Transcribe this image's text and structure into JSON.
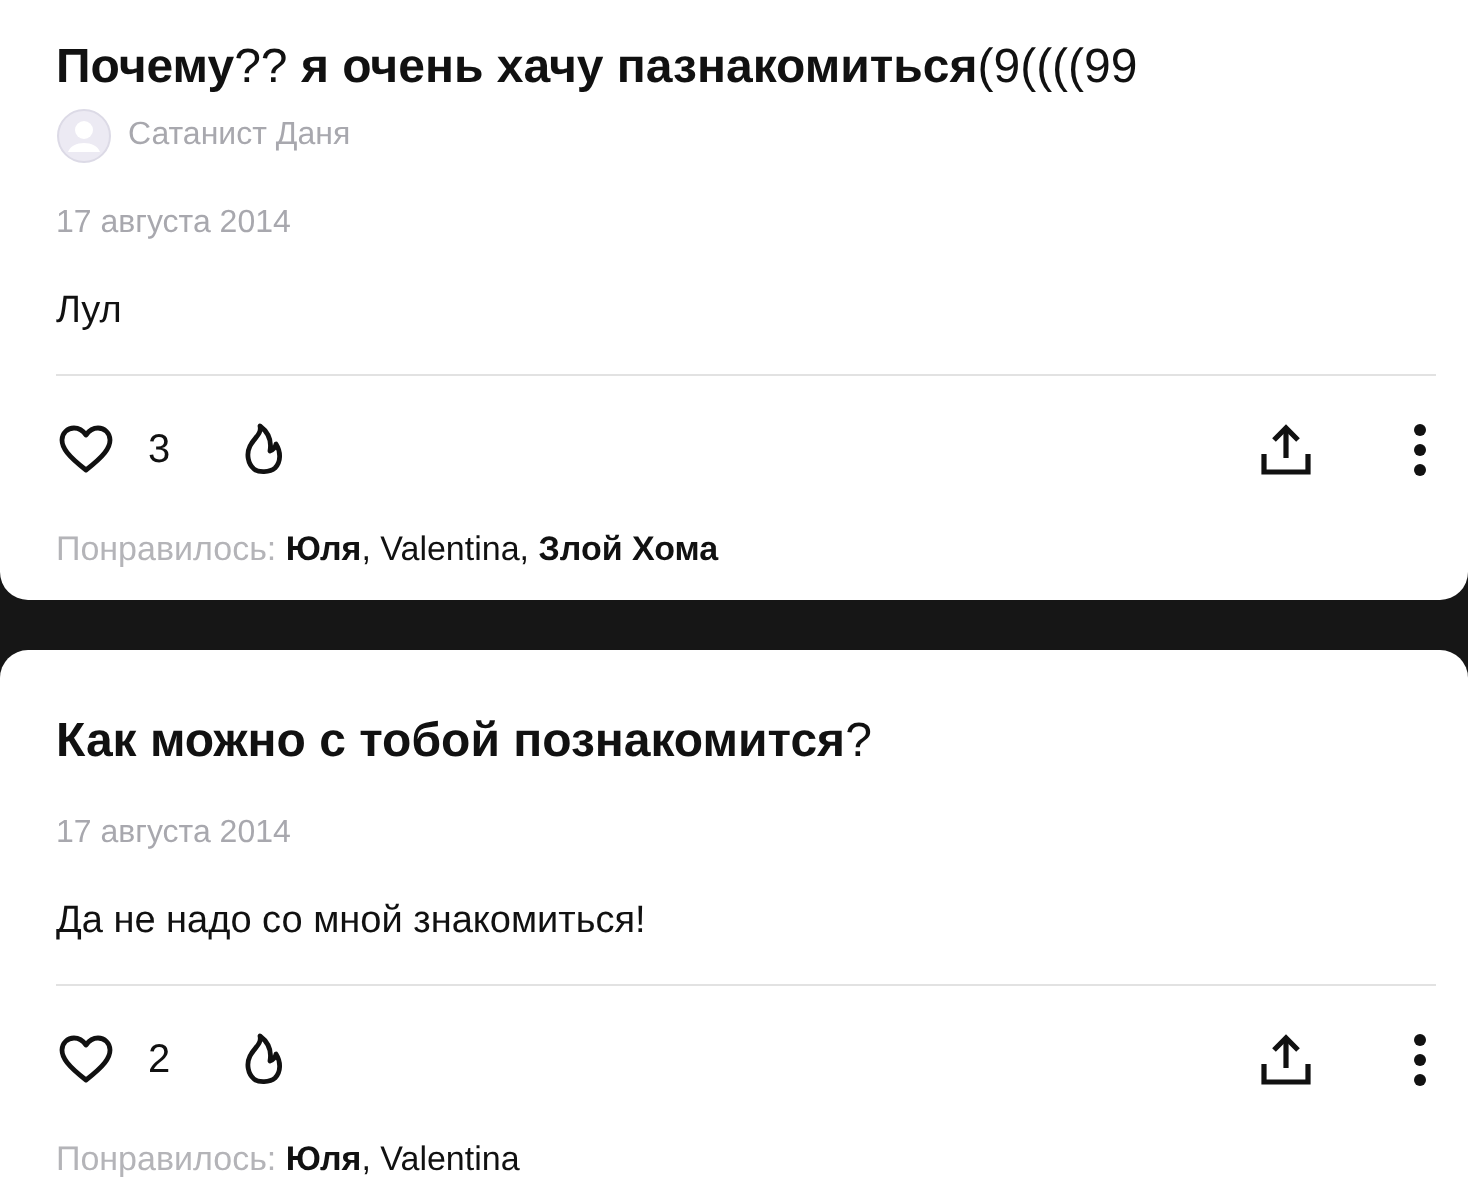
{
  "posts": [
    {
      "title": "**Почему**?? **я очень хачу пазнакомиться**(9((((99",
      "author": "Сатанист Даня",
      "date": "17 августа 2014",
      "body": "Лул",
      "like_count": "3",
      "liked_label": "Понравилось:",
      "liked_names": "**Юля**, Valentina, **Злой Хома**"
    },
    {
      "title": "**Как можно с тобой познакомится**?",
      "date": "17 августа 2014",
      "body": "Да не надо со мной знакомиться!",
      "like_count": "2",
      "liked_label": "Понравилось:",
      "liked_names": "**Юля**, Valentina"
    }
  ]
}
